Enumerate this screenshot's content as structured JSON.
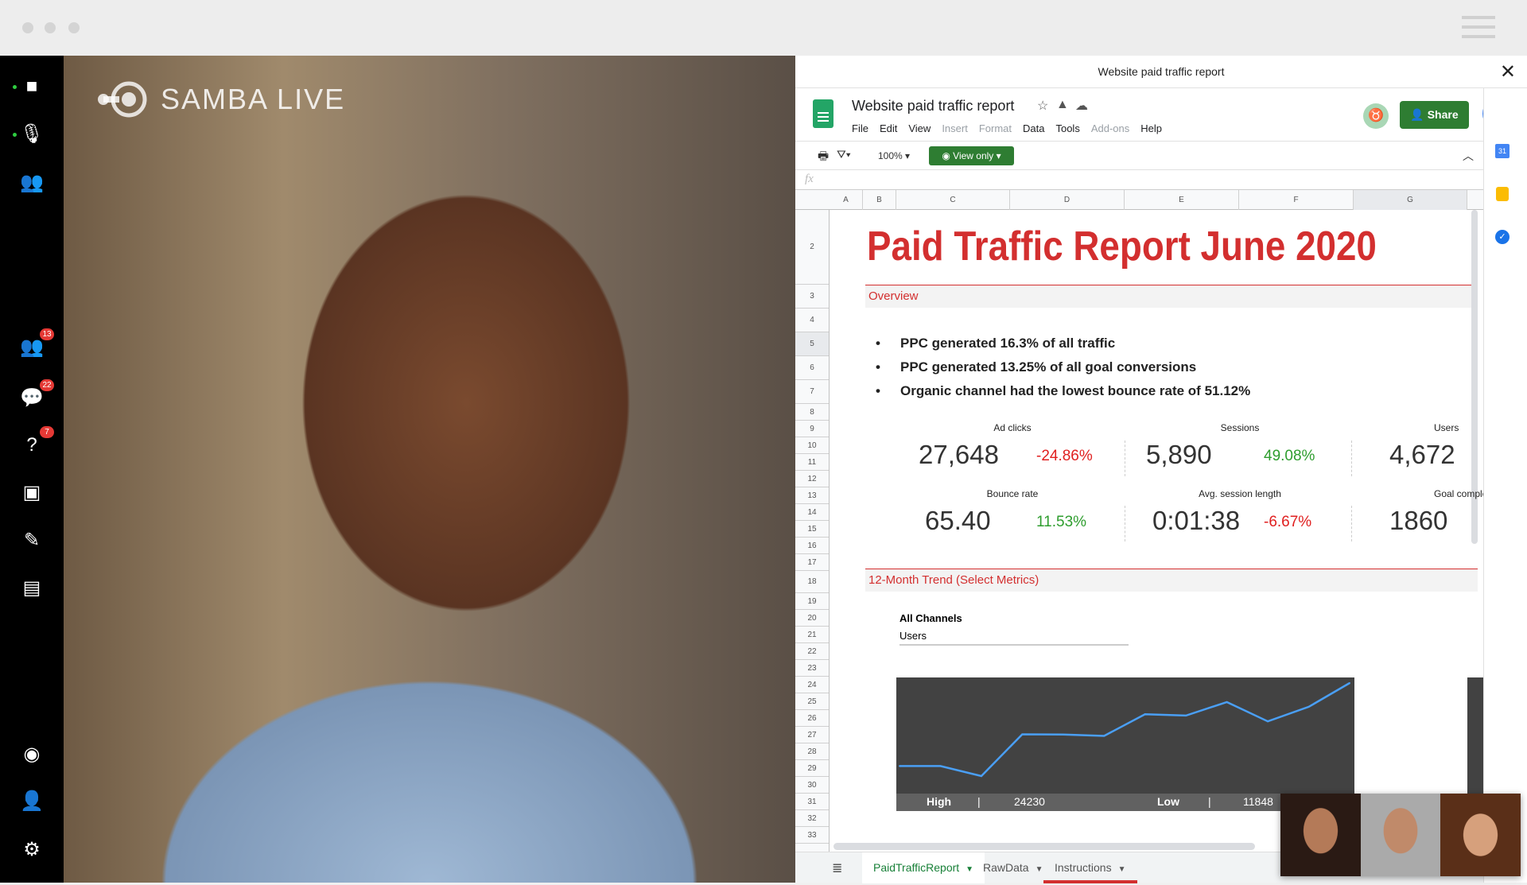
{
  "app": {
    "brand": "SAMBA LIVE"
  },
  "sidebar": {
    "items": [
      {
        "icon": "video-camera-icon",
        "badge": null
      },
      {
        "icon": "microphone-icon",
        "badge": null
      },
      {
        "icon": "screen-share-person-icon",
        "badge": null
      },
      {
        "icon": "participants-icon",
        "badge": "13"
      },
      {
        "icon": "chat-icon",
        "badge": "22"
      },
      {
        "icon": "question-icon",
        "badge": "7"
      },
      {
        "icon": "presentation-icon",
        "badge": null
      },
      {
        "icon": "pencil-icon",
        "badge": null
      },
      {
        "icon": "report-icon",
        "badge": null
      },
      {
        "icon": "record-icon",
        "badge": null
      },
      {
        "icon": "add-user-icon",
        "badge": null
      },
      {
        "icon": "settings-icon",
        "badge": null
      }
    ]
  },
  "panel": {
    "title": "Website paid traffic report"
  },
  "sheets": {
    "doc_title": "Website paid traffic report",
    "menu": [
      {
        "label": "File",
        "enabled": true
      },
      {
        "label": "Edit",
        "enabled": true
      },
      {
        "label": "View",
        "enabled": true
      },
      {
        "label": "Insert",
        "enabled": false
      },
      {
        "label": "Format",
        "enabled": false
      },
      {
        "label": "Data",
        "enabled": true
      },
      {
        "label": "Tools",
        "enabled": true
      },
      {
        "label": "Add-ons",
        "enabled": false
      },
      {
        "label": "Help",
        "enabled": true
      }
    ],
    "share_label": "Share",
    "zoom": "100%",
    "view_mode": "View only",
    "fx": "fx",
    "columns": [
      "A",
      "B",
      "C",
      "D",
      "E",
      "F",
      "G"
    ],
    "rows": [
      "2",
      "3",
      "4",
      "5",
      "6",
      "7",
      "8",
      "9",
      "10",
      "11",
      "12",
      "13",
      "14",
      "15",
      "16",
      "17",
      "18",
      "19",
      "20",
      "21",
      "22",
      "23",
      "24",
      "25",
      "26",
      "27",
      "28",
      "29",
      "30",
      "31",
      "32",
      "33"
    ],
    "tabs": [
      {
        "label": "PaidTrafficReport",
        "active": true
      },
      {
        "label": "RawData",
        "active": false
      },
      {
        "label": "Instructions",
        "active": false
      }
    ]
  },
  "report": {
    "title": "Paid Traffic Report June 2020",
    "overview_label": "Overview",
    "bullets": [
      "PPC generated 16.3% of all traffic",
      "PPC generated 13.25% of all goal conversions",
      "Organic channel had the lowest bounce rate of 51.12%"
    ],
    "kpis": [
      {
        "label": "Ad clicks",
        "value": "27,648",
        "change": "-24.86%",
        "trend": "down"
      },
      {
        "label": "Sessions",
        "value": "5,890",
        "change": "49.08%",
        "trend": "up"
      },
      {
        "label": "Users",
        "value": "4,672",
        "change": "",
        "trend": ""
      },
      {
        "label": "Bounce rate",
        "value": "65.40",
        "change": "11.53%",
        "trend": "up"
      },
      {
        "label": "Avg. session length",
        "value": "0:01:38",
        "change": "-6.67%",
        "trend": "down"
      },
      {
        "label": "Goal completions",
        "value": "1860",
        "change": "",
        "trend": ""
      }
    ],
    "trend_label": "12-Month Trend (Select Metrics)",
    "chart_title": "All Channels",
    "chart_metric": "Users",
    "high_label": "High",
    "high_value": "24230",
    "low_label": "Low",
    "low_value": "11848",
    "sep": "|"
  },
  "colors": {
    "accent_red": "#d32f2f",
    "green": "#2e7d32",
    "positive": "#2e9d2e",
    "negative": "#e02020",
    "line": "#4a9ff5"
  },
  "chart_data": {
    "type": "line",
    "values": [
      13185,
      13185,
      11848,
      17406,
      17371,
      17195,
      20079,
      19903,
      21697,
      19129,
      21064,
      24230
    ],
    "title": "All Channels",
    "ylabel": "Users",
    "grid": false
  }
}
